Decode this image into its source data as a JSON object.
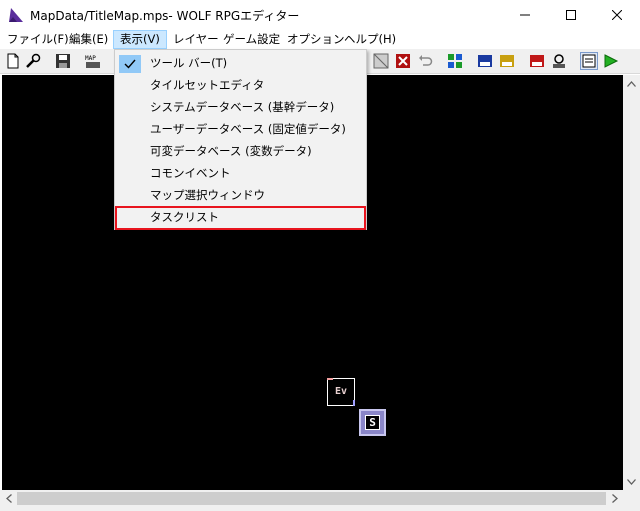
{
  "window": {
    "title": "MapData/TitleMap.mps- WOLF RPGエディター",
    "controls": [
      "minimize-icon",
      "maximize-icon",
      "close-icon"
    ]
  },
  "menubar": {
    "items": [
      {
        "label": "ファイル(F)"
      },
      {
        "label": "編集(E)"
      },
      {
        "label": "表示(V)",
        "active": true
      },
      {
        "label": "レイヤー"
      },
      {
        "label": "ゲーム設定"
      },
      {
        "label": "オプション"
      },
      {
        "label": "ヘルプ(H)"
      }
    ]
  },
  "toolbar": {
    "left_icons": [
      "new-file-icon",
      "wrench-icon",
      "save-icon",
      "map-icon"
    ],
    "right_icons": [
      "tileset-icon",
      "delete-icon",
      "undo-icon",
      "event-layer-icon",
      "database-icon",
      "user-db-icon",
      "system-db-icon",
      "common-event-icon",
      "variable-db-icon",
      "map-select-icon",
      "test-play-icon"
    ]
  },
  "view_menu": {
    "items": [
      {
        "label": "ツール バー(T)",
        "checked": true
      },
      {
        "label": "タイルセットエディタ"
      },
      {
        "label": "システムデータベース (基幹データ)"
      },
      {
        "label": "ユーザーデータベース (固定値データ)"
      },
      {
        "label": "可変データベース (変数データ)"
      },
      {
        "label": "コモンイベント"
      },
      {
        "label": "マップ選択ウィンドウ"
      },
      {
        "label": "タスクリスト",
        "highlighted": true
      }
    ]
  },
  "map": {
    "event_label": "Ev",
    "start_label": "S",
    "background": "#000000"
  },
  "colors": {
    "highlight_border": "#e8141e",
    "menu_hover": "#91c9f7",
    "active_menu": "#cce8ff"
  }
}
